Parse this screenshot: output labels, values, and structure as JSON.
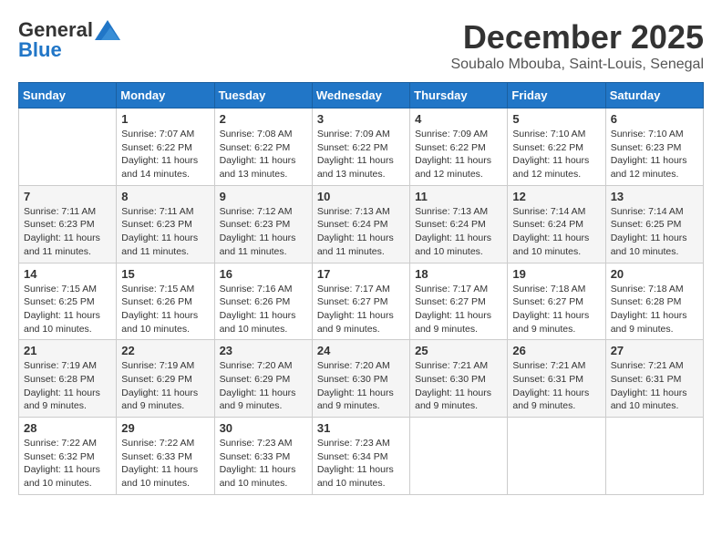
{
  "logo": {
    "general": "General",
    "blue": "Blue"
  },
  "title": {
    "month": "December 2025",
    "location": "Soubalo Mbouba, Saint-Louis, Senegal"
  },
  "days_of_week": [
    "Sunday",
    "Monday",
    "Tuesday",
    "Wednesday",
    "Thursday",
    "Friday",
    "Saturday"
  ],
  "weeks": [
    [
      {
        "day": "",
        "sunrise": "",
        "sunset": "",
        "daylight": ""
      },
      {
        "day": "1",
        "sunrise": "Sunrise: 7:07 AM",
        "sunset": "Sunset: 6:22 PM",
        "daylight": "Daylight: 11 hours and 14 minutes."
      },
      {
        "day": "2",
        "sunrise": "Sunrise: 7:08 AM",
        "sunset": "Sunset: 6:22 PM",
        "daylight": "Daylight: 11 hours and 13 minutes."
      },
      {
        "day": "3",
        "sunrise": "Sunrise: 7:09 AM",
        "sunset": "Sunset: 6:22 PM",
        "daylight": "Daylight: 11 hours and 13 minutes."
      },
      {
        "day": "4",
        "sunrise": "Sunrise: 7:09 AM",
        "sunset": "Sunset: 6:22 PM",
        "daylight": "Daylight: 11 hours and 12 minutes."
      },
      {
        "day": "5",
        "sunrise": "Sunrise: 7:10 AM",
        "sunset": "Sunset: 6:22 PM",
        "daylight": "Daylight: 11 hours and 12 minutes."
      },
      {
        "day": "6",
        "sunrise": "Sunrise: 7:10 AM",
        "sunset": "Sunset: 6:23 PM",
        "daylight": "Daylight: 11 hours and 12 minutes."
      }
    ],
    [
      {
        "day": "7",
        "sunrise": "Sunrise: 7:11 AM",
        "sunset": "Sunset: 6:23 PM",
        "daylight": "Daylight: 11 hours and 11 minutes."
      },
      {
        "day": "8",
        "sunrise": "Sunrise: 7:11 AM",
        "sunset": "Sunset: 6:23 PM",
        "daylight": "Daylight: 11 hours and 11 minutes."
      },
      {
        "day": "9",
        "sunrise": "Sunrise: 7:12 AM",
        "sunset": "Sunset: 6:23 PM",
        "daylight": "Daylight: 11 hours and 11 minutes."
      },
      {
        "day": "10",
        "sunrise": "Sunrise: 7:13 AM",
        "sunset": "Sunset: 6:24 PM",
        "daylight": "Daylight: 11 hours and 11 minutes."
      },
      {
        "day": "11",
        "sunrise": "Sunrise: 7:13 AM",
        "sunset": "Sunset: 6:24 PM",
        "daylight": "Daylight: 11 hours and 10 minutes."
      },
      {
        "day": "12",
        "sunrise": "Sunrise: 7:14 AM",
        "sunset": "Sunset: 6:24 PM",
        "daylight": "Daylight: 11 hours and 10 minutes."
      },
      {
        "day": "13",
        "sunrise": "Sunrise: 7:14 AM",
        "sunset": "Sunset: 6:25 PM",
        "daylight": "Daylight: 11 hours and 10 minutes."
      }
    ],
    [
      {
        "day": "14",
        "sunrise": "Sunrise: 7:15 AM",
        "sunset": "Sunset: 6:25 PM",
        "daylight": "Daylight: 11 hours and 10 minutes."
      },
      {
        "day": "15",
        "sunrise": "Sunrise: 7:15 AM",
        "sunset": "Sunset: 6:26 PM",
        "daylight": "Daylight: 11 hours and 10 minutes."
      },
      {
        "day": "16",
        "sunrise": "Sunrise: 7:16 AM",
        "sunset": "Sunset: 6:26 PM",
        "daylight": "Daylight: 11 hours and 10 minutes."
      },
      {
        "day": "17",
        "sunrise": "Sunrise: 7:17 AM",
        "sunset": "Sunset: 6:27 PM",
        "daylight": "Daylight: 11 hours and 9 minutes."
      },
      {
        "day": "18",
        "sunrise": "Sunrise: 7:17 AM",
        "sunset": "Sunset: 6:27 PM",
        "daylight": "Daylight: 11 hours and 9 minutes."
      },
      {
        "day": "19",
        "sunrise": "Sunrise: 7:18 AM",
        "sunset": "Sunset: 6:27 PM",
        "daylight": "Daylight: 11 hours and 9 minutes."
      },
      {
        "day": "20",
        "sunrise": "Sunrise: 7:18 AM",
        "sunset": "Sunset: 6:28 PM",
        "daylight": "Daylight: 11 hours and 9 minutes."
      }
    ],
    [
      {
        "day": "21",
        "sunrise": "Sunrise: 7:19 AM",
        "sunset": "Sunset: 6:28 PM",
        "daylight": "Daylight: 11 hours and 9 minutes."
      },
      {
        "day": "22",
        "sunrise": "Sunrise: 7:19 AM",
        "sunset": "Sunset: 6:29 PM",
        "daylight": "Daylight: 11 hours and 9 minutes."
      },
      {
        "day": "23",
        "sunrise": "Sunrise: 7:20 AM",
        "sunset": "Sunset: 6:29 PM",
        "daylight": "Daylight: 11 hours and 9 minutes."
      },
      {
        "day": "24",
        "sunrise": "Sunrise: 7:20 AM",
        "sunset": "Sunset: 6:30 PM",
        "daylight": "Daylight: 11 hours and 9 minutes."
      },
      {
        "day": "25",
        "sunrise": "Sunrise: 7:21 AM",
        "sunset": "Sunset: 6:30 PM",
        "daylight": "Daylight: 11 hours and 9 minutes."
      },
      {
        "day": "26",
        "sunrise": "Sunrise: 7:21 AM",
        "sunset": "Sunset: 6:31 PM",
        "daylight": "Daylight: 11 hours and 9 minutes."
      },
      {
        "day": "27",
        "sunrise": "Sunrise: 7:21 AM",
        "sunset": "Sunset: 6:31 PM",
        "daylight": "Daylight: 11 hours and 10 minutes."
      }
    ],
    [
      {
        "day": "28",
        "sunrise": "Sunrise: 7:22 AM",
        "sunset": "Sunset: 6:32 PM",
        "daylight": "Daylight: 11 hours and 10 minutes."
      },
      {
        "day": "29",
        "sunrise": "Sunrise: 7:22 AM",
        "sunset": "Sunset: 6:33 PM",
        "daylight": "Daylight: 11 hours and 10 minutes."
      },
      {
        "day": "30",
        "sunrise": "Sunrise: 7:23 AM",
        "sunset": "Sunset: 6:33 PM",
        "daylight": "Daylight: 11 hours and 10 minutes."
      },
      {
        "day": "31",
        "sunrise": "Sunrise: 7:23 AM",
        "sunset": "Sunset: 6:34 PM",
        "daylight": "Daylight: 11 hours and 10 minutes."
      },
      {
        "day": "",
        "sunrise": "",
        "sunset": "",
        "daylight": ""
      },
      {
        "day": "",
        "sunrise": "",
        "sunset": "",
        "daylight": ""
      },
      {
        "day": "",
        "sunrise": "",
        "sunset": "",
        "daylight": ""
      }
    ]
  ]
}
